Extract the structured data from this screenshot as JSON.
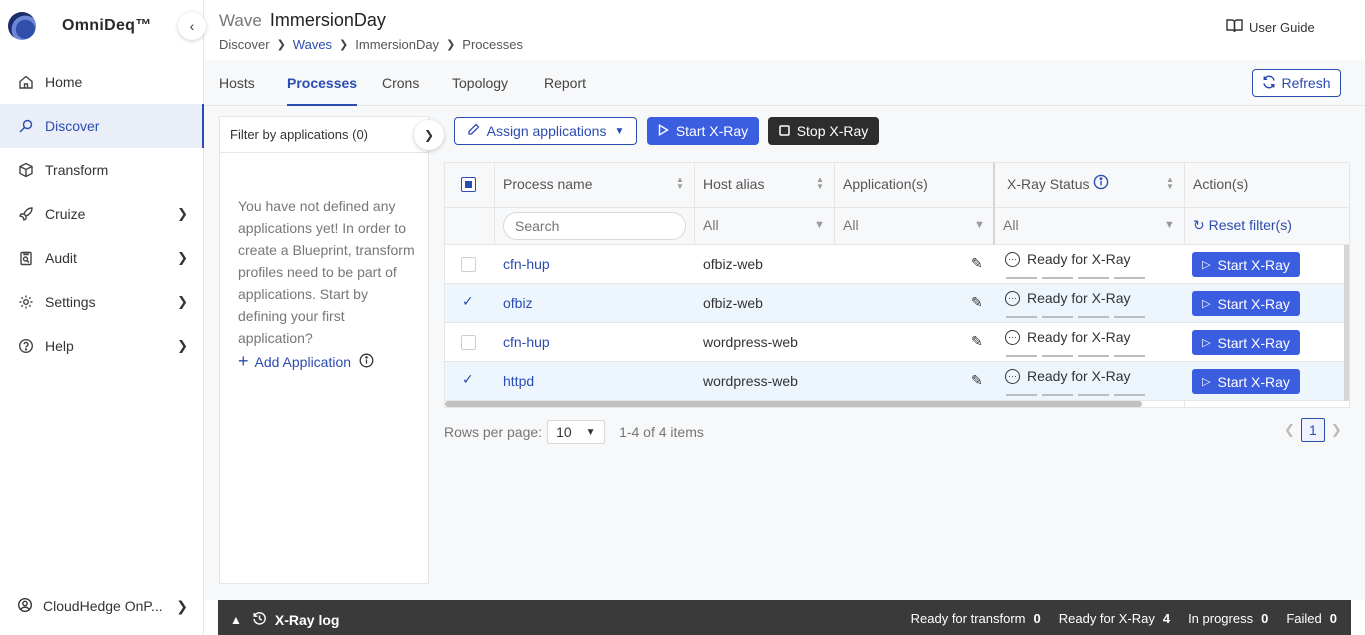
{
  "app": {
    "name": "OmniDeq™",
    "collapse_icon": "chevron-left-icon"
  },
  "sidebar": {
    "items": [
      {
        "label": "Home",
        "icon": "home-icon",
        "has_submenu": false,
        "active": false
      },
      {
        "label": "Discover",
        "icon": "discover-icon",
        "has_submenu": false,
        "active": true
      },
      {
        "label": "Transform",
        "icon": "cube-icon",
        "has_submenu": false,
        "active": false
      },
      {
        "label": "Cruize",
        "icon": "rocket-icon",
        "has_submenu": true,
        "active": false
      },
      {
        "label": "Audit",
        "icon": "clipboard-icon",
        "has_submenu": true,
        "active": false
      },
      {
        "label": "Settings",
        "icon": "gear-icon",
        "has_submenu": true,
        "active": false
      },
      {
        "label": "Help",
        "icon": "help-icon",
        "has_submenu": true,
        "active": false
      }
    ],
    "footer": {
      "label": "CloudHedge OnP...",
      "icon": "user-circle-icon"
    }
  },
  "header": {
    "title_prefix": "Wave",
    "title": "ImmersionDay",
    "breadcrumb": [
      "Discover",
      "Waves",
      "ImmersionDay",
      "Processes"
    ],
    "user_guide": "User Guide"
  },
  "tabs": [
    {
      "label": "Hosts",
      "active": false
    },
    {
      "label": "Processes",
      "active": true
    },
    {
      "label": "Crons",
      "active": false
    },
    {
      "label": "Topology",
      "active": false
    },
    {
      "label": "Report",
      "active": false
    }
  ],
  "refresh_label": "Refresh",
  "filter_panel": {
    "title": "Filter by applications (0)",
    "empty_message": "You have not defined any applications yet! In order to create a Blueprint, transform profiles need to be part of applications. Start by defining your first application?",
    "add_label": "Add Application"
  },
  "toolbar": {
    "assign": "Assign applications",
    "start": "Start X-Ray",
    "stop": "Stop X-Ray"
  },
  "table": {
    "columns": {
      "process": "Process name",
      "host": "Host alias",
      "apps": "Application(s)",
      "status": "X-Ray Status",
      "actions": "Action(s)"
    },
    "filters": {
      "search_placeholder": "Search",
      "host": "All",
      "apps": "All",
      "status": "All",
      "reset": "Reset filter(s)"
    },
    "rows": [
      {
        "process": "cfn-hup",
        "host": "ofbiz-web",
        "status": "Ready for X-Ray",
        "action": "Start X-Ray",
        "selected": false
      },
      {
        "process": "ofbiz",
        "host": "ofbiz-web",
        "status": "Ready for X-Ray",
        "action": "Start X-Ray",
        "selected": true
      },
      {
        "process": "cfn-hup",
        "host": "wordpress-web",
        "status": "Ready for X-Ray",
        "action": "Start X-Ray",
        "selected": false
      },
      {
        "process": "httpd",
        "host": "wordpress-web",
        "status": "Ready for X-Ray",
        "action": "Start X-Ray",
        "selected": true
      }
    ]
  },
  "pagination": {
    "rows_per_page_label": "Rows per page:",
    "rows_per_page": "10",
    "range": "1-4 of 4 items",
    "current_page": "1"
  },
  "log": {
    "title": "X-Ray log",
    "stats": [
      {
        "label": "Ready for transform",
        "value": "0"
      },
      {
        "label": "Ready for X-Ray",
        "value": "4"
      },
      {
        "label": "In progress",
        "value": "0"
      },
      {
        "label": "Failed",
        "value": "0"
      }
    ]
  },
  "colors": {
    "accent": "#2b4cb0",
    "primary_button": "#3b5ee0",
    "dark_button": "#2d2d2d",
    "log_bar": "#3a3a3a"
  }
}
